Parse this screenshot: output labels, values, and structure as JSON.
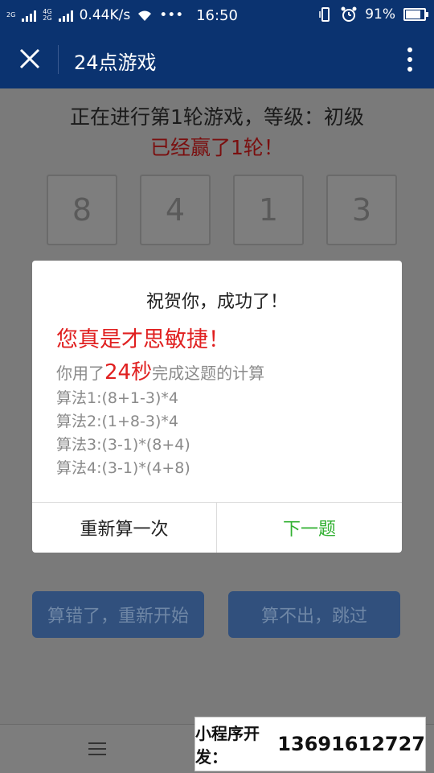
{
  "status_bar": {
    "net_top": "2G",
    "net_mid": "4G",
    "net_bot": "2G",
    "speed": "0.44K/s",
    "dots": "•••",
    "time": "16:50",
    "battery": "91%",
    "battery_level": 0.91
  },
  "nav": {
    "title": "24点游戏"
  },
  "game": {
    "round_text": "正在进行第1轮游戏，等级：初级",
    "won_text": "已经赢了1轮！",
    "cards": [
      "8",
      "4",
      "1",
      "3"
    ],
    "btn_wrong": "算错了，重新开始",
    "btn_skip": "算不出，跳过"
  },
  "modal": {
    "title": "祝贺你，成功了！",
    "praise": "您真是才思敏捷！",
    "time_prefix": "你用了",
    "time_value": "24秒",
    "time_suffix": "完成这题的计算",
    "algorithms": [
      "算法1:(8+1-3)*4",
      "算法2:(1+8-3)*4",
      "算法3:(3-1)*(8+4)",
      "算法4:(3-1)*(4+8)"
    ],
    "btn_retry": "重新算一次",
    "btn_next": "下一题"
  },
  "banner": {
    "label": "小程序开发：",
    "phone": "13691612727"
  },
  "colors": {
    "header_bg": "#0b3370",
    "accent_red": "#e02020",
    "next_green": "#31b031"
  },
  "icons": [
    "signal-icon",
    "wifi-icon",
    "vibrate-icon",
    "alarm-icon",
    "battery-icon",
    "close-icon",
    "more-vertical-icon",
    "menu-icon"
  ]
}
